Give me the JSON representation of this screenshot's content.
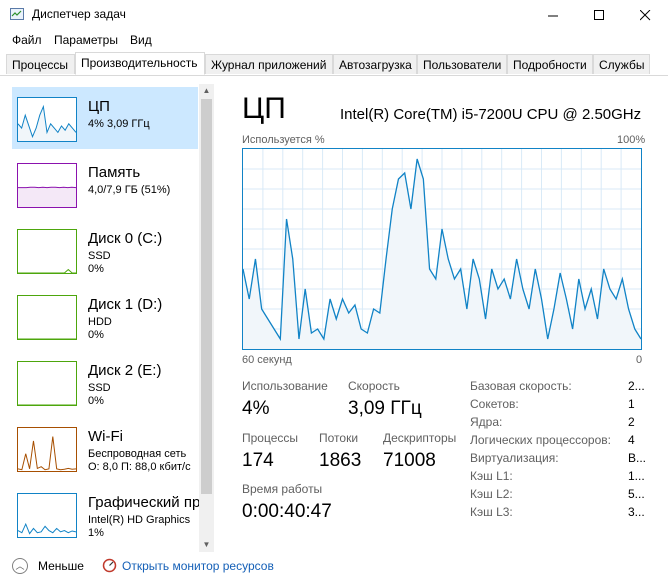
{
  "window": {
    "title": "Диспетчер задач",
    "minimize_icon": "minimize-icon",
    "maximize_icon": "maximize-icon",
    "close_icon": "close-icon"
  },
  "menu": [
    "Файл",
    "Параметры",
    "Вид"
  ],
  "tabs": [
    "Процессы",
    "Производительность",
    "Журнал приложений",
    "Автозагрузка",
    "Пользователи",
    "Подробности",
    "Службы"
  ],
  "active_tab": "Производительность",
  "sidebar": [
    {
      "name": "ЦП",
      "line1": "4% 3,09 ГГц",
      "line2": "",
      "color": "#1183c6",
      "bg": "#f1f6fa"
    },
    {
      "name": "Память",
      "line1": "4,0/7,9 ГБ (51%)",
      "line2": "",
      "color": "#8b12ae",
      "bg": "#f4e8f7"
    },
    {
      "name": "Диск 0 (C:)",
      "line1": "SSD",
      "line2": "0%",
      "color": "#4da60c",
      "bg": "#ffffff"
    },
    {
      "name": "Диск 1 (D:)",
      "line1": "HDD",
      "line2": "0%",
      "color": "#4da60c",
      "bg": "#ffffff"
    },
    {
      "name": "Диск 2 (E:)",
      "line1": "SSD",
      "line2": "0%",
      "color": "#4da60c",
      "bg": "#ffffff"
    },
    {
      "name": "Wi-Fi",
      "line1": "Беспроводная сеть",
      "line2": "О: 8,0 П: 88,0 кбит/с",
      "color": "#a74f01",
      "bg": "#ffffff"
    },
    {
      "name": "Графический пр",
      "line1": "Intel(R) HD Graphics",
      "line2": "1%",
      "color": "#1183c6",
      "bg": "#ffffff"
    }
  ],
  "header": {
    "title": "ЦП",
    "cpu_model": "Intel(R) Core(TM) i5-7200U CPU @ 2.50GHz"
  },
  "graph": {
    "top_left": "Используется %",
    "top_right": "100%",
    "bottom_left": "60 секунд",
    "bottom_right": "0"
  },
  "chart_data": {
    "type": "area",
    "ylim": [
      0,
      100
    ],
    "values": [
      40,
      25,
      45,
      20,
      15,
      10,
      5,
      65,
      45,
      5,
      30,
      8,
      10,
      5,
      25,
      15,
      25,
      18,
      22,
      10,
      8,
      20,
      18,
      45,
      70,
      85,
      88,
      70,
      95,
      85,
      40,
      35,
      60,
      45,
      35,
      40,
      20,
      45,
      35,
      15,
      40,
      30,
      35,
      25,
      45,
      30,
      20,
      40,
      25,
      5,
      20,
      38,
      25,
      10,
      35,
      20,
      30,
      15,
      40,
      30,
      25,
      35,
      20,
      10,
      5
    ]
  },
  "stats": {
    "usage_label": "Использование",
    "usage_value": "4%",
    "speed_label": "Скорость",
    "speed_value": "3,09 ГГц",
    "proc_label": "Процессы",
    "proc_value": "174",
    "threads_label": "Потоки",
    "threads_value": "1863",
    "handles_label": "Дескрипторы",
    "handles_value": "71008",
    "uptime_label": "Время работы",
    "uptime_value": "0:00:40:47"
  },
  "info": [
    {
      "label": "Базовая скорость:",
      "value": "2..."
    },
    {
      "label": "Сокетов:",
      "value": "1"
    },
    {
      "label": "Ядра:",
      "value": "2"
    },
    {
      "label": "Логических процессоров:",
      "value": "4"
    },
    {
      "label": "Виртуализация:",
      "value": "В..."
    },
    {
      "label": "Кэш L1:",
      "value": "1..."
    },
    {
      "label": "Кэш L2:",
      "value": "5..."
    },
    {
      "label": "Кэш L3:",
      "value": "3..."
    }
  ],
  "bottom": {
    "less": "Меньше",
    "resmon": "Открыть монитор ресурсов"
  }
}
